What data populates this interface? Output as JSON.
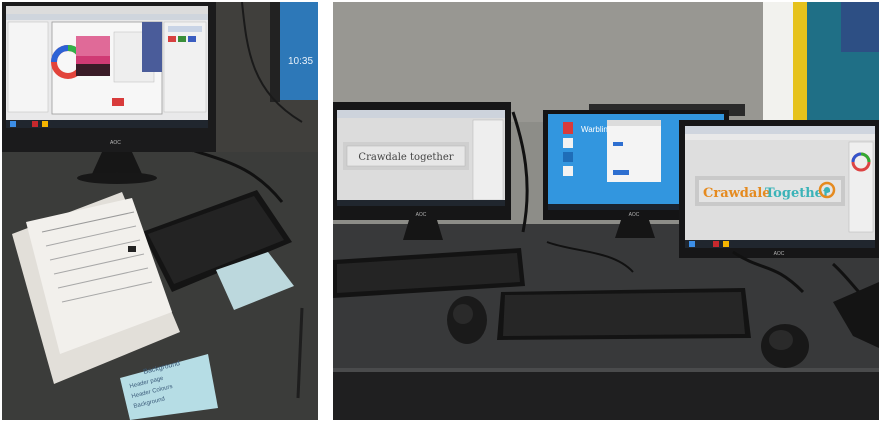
{
  "left_photo": {
    "monitor_clock": "10:35",
    "monitor_brand": "AOC",
    "sticky_note_lines": [
      "Background",
      "Header page",
      "Header Colours",
      "Background"
    ]
  },
  "right_photo": {
    "left_screen_banner_text": "Crawdale together",
    "middle_screen_logo_text": "Warbling School",
    "right_screen_banner_text_1": "Crawdale",
    "right_screen_banner_text_2": "Together",
    "monitor_brand": "AOC"
  },
  "colors": {
    "desk": "#3a3b3a",
    "wall": "#8b8b86",
    "yellow_wall": "#e6c21c",
    "banner_orange": "#e58a1f",
    "banner_teal": "#3bb3b8"
  }
}
